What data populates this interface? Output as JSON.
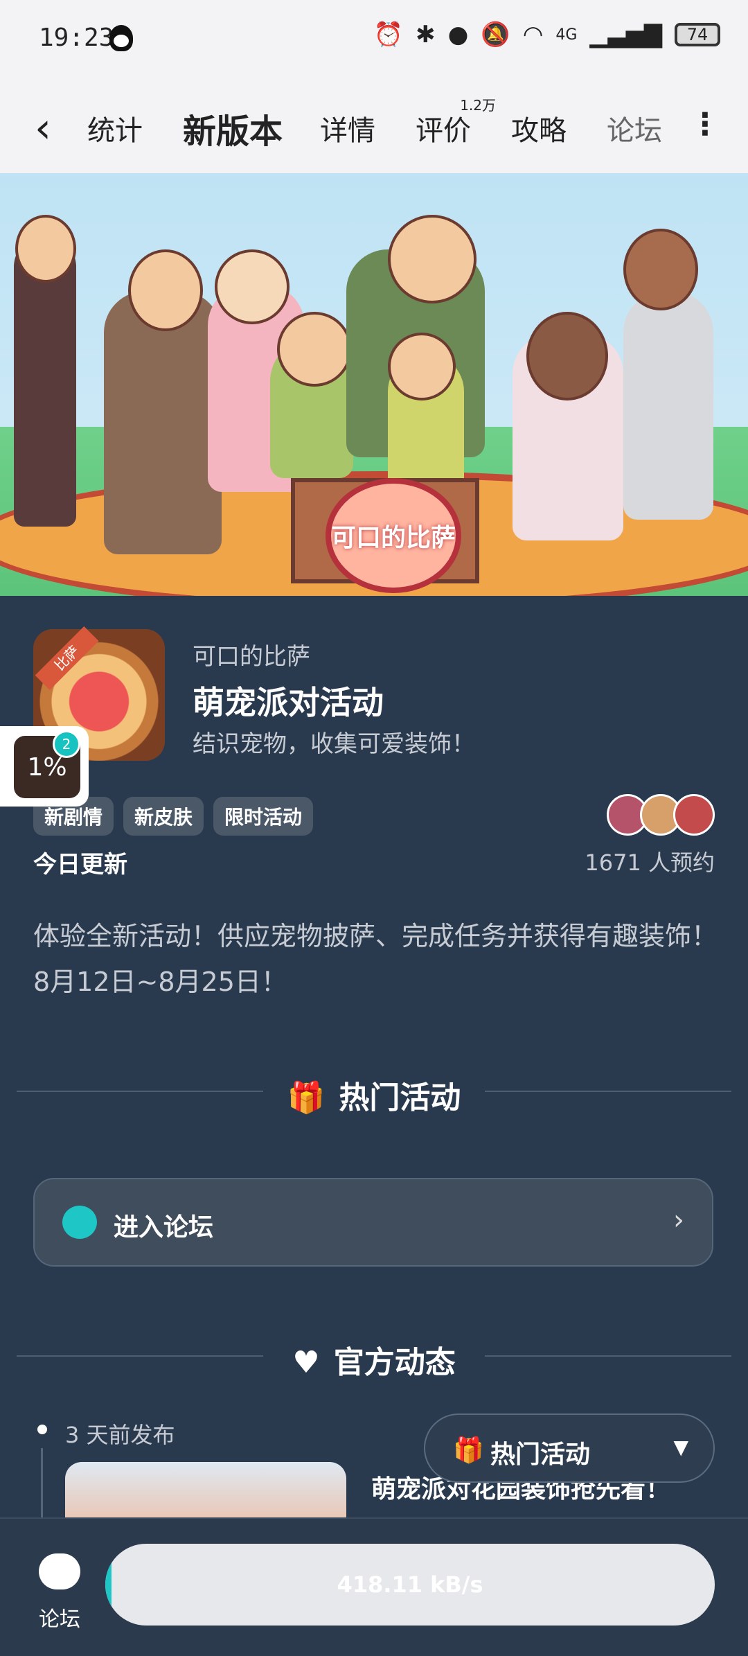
{
  "status_bar": {
    "time": "19:23",
    "battery": "74",
    "network": "4G"
  },
  "tabs": [
    {
      "label": "统计",
      "active": false
    },
    {
      "label": "新版本",
      "active": true
    },
    {
      "label": "详情",
      "active": false
    },
    {
      "label": "评价",
      "active": false,
      "badge": "1.2万"
    },
    {
      "label": "攻略",
      "active": false
    },
    {
      "label": "论坛",
      "active": false
    }
  ],
  "banner": {
    "logo_text": "可口的比萨"
  },
  "app": {
    "icon_ribbon": "比萨",
    "game_name": "可口的比萨",
    "event_title": "萌宠派对活动",
    "event_subtitle": "结识宠物，收集可爱装饰！",
    "tags": [
      "新剧情",
      "新皮肤",
      "限时活动"
    ],
    "update_label": "今日更新",
    "reservations": "1671 人预约"
  },
  "floating_widget": {
    "percent": "1%",
    "badge": "2"
  },
  "description": "体验全新活动！供应宠物披萨、完成任务并获得有趣装饰！8月12日~8月25日！",
  "sections": {
    "hot": "热门活动",
    "official": "官方动态"
  },
  "forum_entry": {
    "label": "进入论坛"
  },
  "post": {
    "time": "3 天前发布",
    "title": "萌宠派对花园装饰抢先看！"
  },
  "hot_button": {
    "label": "热门活动"
  },
  "bottom_bar": {
    "forum_label": "论坛",
    "download_speed": "418.11 kB/s",
    "progress": 0.01
  },
  "colors": {
    "accent": "#1ec6c6",
    "background": "#2a3a4e"
  }
}
